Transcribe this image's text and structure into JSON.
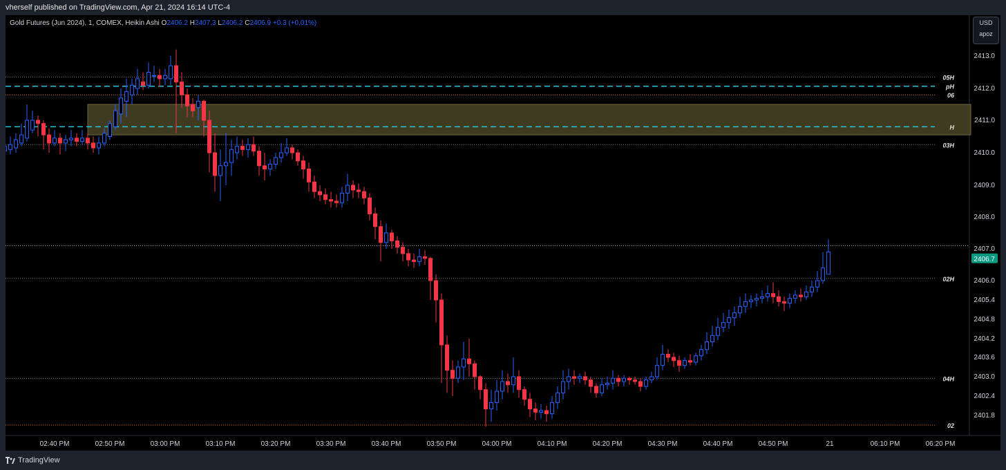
{
  "header": {
    "text": "vherself published on TradingView.com, Apr 21, 2024 16:14 UTC-4"
  },
  "legend": {
    "symbol": "Gold Futures (Jun 2024), 1, COMEX, Heikin Ashi",
    "o_label": "O",
    "o": "2406.2",
    "h_label": "H",
    "h": "2407.3",
    "l_label": "L",
    "l": "2406.2",
    "c_label": "C",
    "c": "2406.9",
    "change": "+0.3 (+0.01%)"
  },
  "currency": {
    "unit": "USD",
    "user": "apoz"
  },
  "footer": {
    "brand": "TradingView"
  },
  "colors": {
    "up": "#2962ff",
    "down": "#f23645",
    "zone": "#4a4526",
    "cyan": "#26c6da",
    "last_price_bg": "#089981"
  },
  "chart_data": {
    "type": "candlestick",
    "title": "",
    "y_ticks": [
      "2413.0",
      "2412.0",
      "2411.0",
      "2410.0",
      "2409.0",
      "2408.0",
      "2407.0",
      "2406.0",
      "2405.4",
      "2404.8",
      "2404.2",
      "2403.6",
      "2403.0",
      "2402.4",
      "2401.8"
    ],
    "x_ticks": [
      "02:40 PM",
      "02:50 PM",
      "03:00 PM",
      "03:10 PM",
      "03:20 PM",
      "03:30 PM",
      "03:40 PM",
      "03:50 PM",
      "04:00 PM",
      "04:10 PM",
      "04:20 PM",
      "04:30 PM",
      "04:40 PM",
      "04:50 PM",
      "21",
      "06:10 PM",
      "06:20 PM"
    ],
    "last_price": "2406.7",
    "levels": [
      {
        "label": "05H",
        "price": 2412.35,
        "style": "dotted",
        "color": "#787b86"
      },
      {
        "label": "pH",
        "price": 2412.07,
        "style": "dashed",
        "color": "#26c6da"
      },
      {
        "label": "06",
        "price": 2411.8,
        "style": "dotted",
        "color": "#f57c00"
      },
      {
        "label": "H",
        "price": 2410.8,
        "style": "dashed",
        "color": "#26c6da"
      },
      {
        "label": "03H",
        "price": 2410.25,
        "style": "dotted",
        "color": "#787b86"
      },
      {
        "label": "02H",
        "price": 2406.07,
        "style": "dotted",
        "color": "#787b86"
      },
      {
        "label": "04H",
        "price": 2402.95,
        "style": "dotted",
        "color": "#787b86"
      },
      {
        "label": "02",
        "price": 2401.5,
        "style": "dotted",
        "color": "#f57c00"
      }
    ],
    "current_line": {
      "price": 2407.1
    },
    "zone": {
      "top": 2411.5,
      "bottom": 2410.55,
      "from_time": "02:46 PM"
    },
    "candles": [
      [
        "02:30 PM",
        2410.0,
        2410.35,
        2409.75,
        2410.1
      ],
      [
        "02:31 PM",
        2410.05,
        2410.45,
        2409.9,
        2410.2
      ],
      [
        "02:32 PM",
        2410.1,
        2410.5,
        2409.95,
        2410.25
      ],
      [
        "02:33 PM",
        2410.15,
        2410.6,
        2410.0,
        2410.4
      ],
      [
        "02:34 PM",
        2410.3,
        2410.9,
        2410.2,
        2410.55
      ],
      [
        "02:35 PM",
        2410.45,
        2411.5,
        2410.35,
        2411.0
      ],
      [
        "02:36 PM",
        2410.7,
        2411.3,
        2410.6,
        2411.0
      ],
      [
        "02:37 PM",
        2411.0,
        2411.15,
        2410.5,
        2410.9
      ],
      [
        "02:38 PM",
        2410.9,
        2411.0,
        2410.1,
        2410.55
      ],
      [
        "02:39 PM",
        2410.55,
        2410.75,
        2410.0,
        2410.3
      ],
      [
        "02:40 PM",
        2410.3,
        2410.7,
        2410.2,
        2410.45
      ],
      [
        "02:41 PM",
        2410.45,
        2410.6,
        2409.95,
        2410.3
      ],
      [
        "02:42 PM",
        2410.3,
        2410.55,
        2410.05,
        2410.4
      ],
      [
        "02:43 PM",
        2410.4,
        2410.7,
        2410.2,
        2410.45
      ],
      [
        "02:44 PM",
        2410.45,
        2410.6,
        2410.2,
        2410.35
      ],
      [
        "02:45 PM",
        2410.35,
        2410.7,
        2410.25,
        2410.45
      ],
      [
        "02:46 PM",
        2410.45,
        2410.6,
        2410.1,
        2410.3
      ],
      [
        "02:47 PM",
        2410.3,
        2410.5,
        2410.0,
        2410.15
      ],
      [
        "02:48 PM",
        2410.15,
        2410.5,
        2409.95,
        2410.3
      ],
      [
        "02:49 PM",
        2410.3,
        2410.75,
        2410.2,
        2410.6
      ],
      [
        "02:50 PM",
        2410.5,
        2411.0,
        2410.4,
        2410.9
      ],
      [
        "02:51 PM",
        2410.8,
        2411.5,
        2410.7,
        2411.3
      ],
      [
        "02:52 PM",
        2411.2,
        2412.0,
        2410.9,
        2411.7
      ],
      [
        "02:53 PM",
        2411.6,
        2412.3,
        2411.1,
        2411.9
      ],
      [
        "02:54 PM",
        2411.8,
        2412.3,
        2411.5,
        2412.1
      ],
      [
        "02:55 PM",
        2412.0,
        2412.6,
        2411.8,
        2412.3
      ],
      [
        "02:56 PM",
        2412.2,
        2412.5,
        2411.95,
        2412.1
      ],
      [
        "02:57 PM",
        2412.1,
        2412.8,
        2412.0,
        2412.5
      ],
      [
        "02:58 PM",
        2412.4,
        2412.7,
        2412.2,
        2412.4
      ],
      [
        "02:59 PM",
        2412.4,
        2412.6,
        2412.05,
        2412.3
      ],
      [
        "03:00 PM",
        2412.3,
        2412.6,
        2412.1,
        2412.4
      ],
      [
        "03:01 PM",
        2412.3,
        2413.0,
        2412.1,
        2412.7
      ],
      [
        "03:02 PM",
        2412.7,
        2413.2,
        2410.6,
        2412.2
      ],
      [
        "03:03 PM",
        2412.2,
        2412.5,
        2411.4,
        2411.8
      ],
      [
        "03:04 PM",
        2411.8,
        2412.0,
        2411.1,
        2411.45
      ],
      [
        "03:05 PM",
        2411.5,
        2411.7,
        2411.1,
        2411.3
      ],
      [
        "03:06 PM",
        2411.4,
        2411.8,
        2411.0,
        2411.6
      ],
      [
        "03:07 PM",
        2411.6,
        2411.65,
        2410.5,
        2411.0
      ],
      [
        "03:08 PM",
        2411.0,
        2411.3,
        2409.4,
        2410.0
      ],
      [
        "03:09 PM",
        2410.0,
        2410.6,
        2408.8,
        2409.3
      ],
      [
        "03:10 PM",
        2409.3,
        2410.1,
        2408.5,
        2409.6
      ],
      [
        "03:11 PM",
        2409.6,
        2410.6,
        2409.0,
        2409.7
      ],
      [
        "03:12 PM",
        2409.7,
        2410.4,
        2409.3,
        2410.1
      ],
      [
        "03:13 PM",
        2410.0,
        2410.5,
        2409.8,
        2410.2
      ],
      [
        "03:14 PM",
        2410.2,
        2410.4,
        2409.9,
        2410.1
      ],
      [
        "03:15 PM",
        2410.1,
        2410.45,
        2409.85,
        2410.25
      ],
      [
        "03:16 PM",
        2410.25,
        2410.5,
        2409.9,
        2410.05
      ],
      [
        "03:17 PM",
        2410.05,
        2410.2,
        2409.3,
        2409.6
      ],
      [
        "03:18 PM",
        2409.6,
        2410.0,
        2409.15,
        2409.5
      ],
      [
        "03:19 PM",
        2409.5,
        2409.8,
        2409.3,
        2409.65
      ],
      [
        "03:20 PM",
        2409.65,
        2410.0,
        2409.5,
        2409.85
      ],
      [
        "03:21 PM",
        2409.85,
        2410.3,
        2409.7,
        2410.0
      ],
      [
        "03:22 PM",
        2410.0,
        2410.45,
        2409.9,
        2410.15
      ],
      [
        "03:23 PM",
        2410.15,
        2410.25,
        2409.8,
        2410.0
      ],
      [
        "03:24 PM",
        2410.0,
        2410.1,
        2409.6,
        2409.75
      ],
      [
        "03:25 PM",
        2409.75,
        2409.9,
        2409.2,
        2409.5
      ],
      [
        "03:26 PM",
        2409.5,
        2409.7,
        2408.8,
        2409.1
      ],
      [
        "03:27 PM",
        2409.1,
        2409.3,
        2408.6,
        2408.8
      ],
      [
        "03:28 PM",
        2408.8,
        2409.0,
        2408.5,
        2408.7
      ],
      [
        "03:29 PM",
        2408.7,
        2408.9,
        2408.4,
        2408.55
      ],
      [
        "03:30 PM",
        2408.55,
        2408.8,
        2408.3,
        2408.5
      ],
      [
        "03:31 PM",
        2408.5,
        2408.7,
        2408.3,
        2408.45
      ],
      [
        "03:32 PM",
        2408.45,
        2408.95,
        2408.3,
        2408.75
      ],
      [
        "03:33 PM",
        2408.75,
        2409.35,
        2408.5,
        2409.0
      ],
      [
        "03:34 PM",
        2409.0,
        2409.15,
        2408.6,
        2408.85
      ],
      [
        "03:35 PM",
        2408.85,
        2409.05,
        2408.6,
        2408.8
      ],
      [
        "03:36 PM",
        2408.8,
        2408.95,
        2408.4,
        2408.6
      ],
      [
        "03:37 PM",
        2408.6,
        2408.75,
        2407.9,
        2408.1
      ],
      [
        "03:38 PM",
        2408.1,
        2408.3,
        2407.3,
        2407.7
      ],
      [
        "03:39 PM",
        2407.7,
        2407.9,
        2406.6,
        2407.2
      ],
      [
        "03:40 PM",
        2407.2,
        2407.8,
        2407.0,
        2407.5
      ],
      [
        "03:41 PM",
        2407.5,
        2407.6,
        2407.0,
        2407.25
      ],
      [
        "03:42 PM",
        2407.25,
        2407.4,
        2406.85,
        2407.05
      ],
      [
        "03:43 PM",
        2407.05,
        2407.2,
        2406.6,
        2406.85
      ],
      [
        "03:44 PM",
        2406.85,
        2407.0,
        2406.45,
        2406.65
      ],
      [
        "03:45 PM",
        2406.65,
        2406.85,
        2406.4,
        2406.6
      ],
      [
        "03:46 PM",
        2406.6,
        2407.0,
        2406.45,
        2406.75
      ],
      [
        "03:47 PM",
        2406.75,
        2406.95,
        2406.5,
        2406.7
      ],
      [
        "03:48 PM",
        2406.7,
        2406.75,
        2405.4,
        2406.0
      ],
      [
        "03:49 PM",
        2406.0,
        2406.2,
        2404.7,
        2405.4
      ],
      [
        "03:50 PM",
        2405.4,
        2405.6,
        2402.8,
        2404.0
      ],
      [
        "03:51 PM",
        2404.0,
        2404.3,
        2402.5,
        2403.2
      ],
      [
        "03:52 PM",
        2403.2,
        2403.5,
        2402.4,
        2402.95
      ],
      [
        "03:53 PM",
        2402.95,
        2403.5,
        2402.8,
        2403.3
      ],
      [
        "03:54 PM",
        2403.3,
        2404.1,
        2402.9,
        2403.55
      ],
      [
        "03:55 PM",
        2403.55,
        2404.2,
        2403.0,
        2403.4
      ],
      [
        "03:56 PM",
        2403.4,
        2403.5,
        2402.6,
        2403.0
      ],
      [
        "03:57 PM",
        2403.0,
        2403.05,
        2402.3,
        2402.6
      ],
      [
        "03:58 PM",
        2402.6,
        2402.8,
        2401.45,
        2402.0
      ],
      [
        "03:59 PM",
        2402.0,
        2402.6,
        2401.6,
        2402.2
      ],
      [
        "04:00 PM",
        2402.2,
        2402.9,
        2401.95,
        2402.55
      ],
      [
        "04:01 PM",
        2402.55,
        2403.2,
        2402.3,
        2402.85
      ],
      [
        "04:02 PM",
        2402.85,
        2403.1,
        2402.5,
        2402.75
      ],
      [
        "04:03 PM",
        2402.75,
        2403.6,
        2402.5,
        2403.0
      ],
      [
        "04:04 PM",
        2403.0,
        2403.2,
        2402.35,
        2402.6
      ],
      [
        "04:05 PM",
        2402.6,
        2402.7,
        2402.1,
        2402.3
      ],
      [
        "04:06 PM",
        2402.3,
        2402.5,
        2401.75,
        2402.0
      ],
      [
        "04:07 PM",
        2402.0,
        2402.2,
        2401.65,
        2401.9
      ],
      [
        "04:08 PM",
        2401.9,
        2402.15,
        2401.7,
        2401.95
      ],
      [
        "04:09 PM",
        2401.95,
        2402.1,
        2401.6,
        2401.85
      ],
      [
        "04:10 PM",
        2401.85,
        2402.4,
        2401.7,
        2402.2
      ],
      [
        "04:11 PM",
        2402.2,
        2402.7,
        2402.0,
        2402.5
      ],
      [
        "04:12 PM",
        2402.5,
        2403.2,
        2402.3,
        2402.85
      ],
      [
        "04:13 PM",
        2402.85,
        2403.25,
        2402.6,
        2403.0
      ],
      [
        "04:14 PM",
        2403.0,
        2403.2,
        2402.75,
        2402.95
      ],
      [
        "04:15 PM",
        2402.95,
        2403.1,
        2402.8,
        2403.0
      ],
      [
        "04:16 PM",
        2403.0,
        2403.15,
        2402.75,
        2402.9
      ],
      [
        "04:17 PM",
        2402.9,
        2403.0,
        2402.5,
        2402.7
      ],
      [
        "04:18 PM",
        2402.7,
        2402.8,
        2402.35,
        2402.5
      ],
      [
        "04:19 PM",
        2402.5,
        2402.95,
        2402.4,
        2402.75
      ],
      [
        "04:20 PM",
        2402.75,
        2403.0,
        2402.6,
        2402.8
      ],
      [
        "04:21 PM",
        2402.8,
        2403.2,
        2402.6,
        2402.95
      ],
      [
        "04:22 PM",
        2402.95,
        2403.05,
        2402.7,
        2402.85
      ],
      [
        "04:23 PM",
        2402.85,
        2403.05,
        2402.7,
        2402.95
      ],
      [
        "04:24 PM",
        2402.95,
        2403.0,
        2402.75,
        2402.9
      ],
      [
        "04:25 PM",
        2402.9,
        2403.0,
        2402.75,
        2402.85
      ],
      [
        "04:26 PM",
        2402.85,
        2402.95,
        2402.55,
        2402.7
      ],
      [
        "04:27 PM",
        2402.7,
        2403.0,
        2402.6,
        2402.9
      ],
      [
        "04:28 PM",
        2402.9,
        2403.15,
        2402.8,
        2403.0
      ],
      [
        "04:29 PM",
        2403.0,
        2403.6,
        2402.9,
        2403.35
      ],
      [
        "04:30 PM",
        2403.35,
        2404.0,
        2403.2,
        2403.7
      ],
      [
        "04:31 PM",
        2403.7,
        2403.85,
        2403.45,
        2403.6
      ],
      [
        "04:32 PM",
        2403.6,
        2403.75,
        2403.3,
        2403.5
      ],
      [
        "04:33 PM",
        2403.5,
        2403.65,
        2403.15,
        2403.35
      ],
      [
        "04:34 PM",
        2403.35,
        2403.6,
        2403.25,
        2403.5
      ],
      [
        "04:35 PM",
        2403.5,
        2403.7,
        2403.35,
        2403.45
      ],
      [
        "04:36 PM",
        2403.45,
        2403.75,
        2403.35,
        2403.65
      ],
      [
        "04:37 PM",
        2403.65,
        2404.0,
        2403.5,
        2403.85
      ],
      [
        "04:38 PM",
        2403.85,
        2404.4,
        2403.7,
        2404.1
      ],
      [
        "04:39 PM",
        2404.1,
        2404.6,
        2403.95,
        2404.3
      ],
      [
        "04:40 PM",
        2404.3,
        2404.85,
        2404.15,
        2404.55
      ],
      [
        "04:41 PM",
        2404.55,
        2405.0,
        2404.4,
        2404.7
      ],
      [
        "04:42 PM",
        2404.7,
        2405.1,
        2404.5,
        2404.85
      ],
      [
        "04:43 PM",
        2404.85,
        2405.2,
        2404.6,
        2405.0
      ],
      [
        "04:44 PM",
        2405.0,
        2405.5,
        2404.85,
        2405.2
      ],
      [
        "04:45 PM",
        2405.2,
        2405.6,
        2405.0,
        2405.35
      ],
      [
        "04:46 PM",
        2405.35,
        2405.55,
        2405.15,
        2405.4
      ],
      [
        "04:47 PM",
        2405.4,
        2405.6,
        2405.2,
        2405.45
      ],
      [
        "04:48 PM",
        2405.45,
        2405.7,
        2405.3,
        2405.5
      ],
      [
        "04:49 PM",
        2405.5,
        2405.85,
        2405.35,
        2405.6
      ],
      [
        "04:50 PM",
        2405.6,
        2405.95,
        2405.3,
        2405.5
      ],
      [
        "04:51 PM",
        2405.5,
        2405.7,
        2405.2,
        2405.35
      ],
      [
        "04:52 PM",
        2405.35,
        2405.5,
        2405.05,
        2405.3
      ],
      [
        "04:53 PM",
        2405.3,
        2405.6,
        2405.15,
        2405.45
      ],
      [
        "04:54 PM",
        2405.45,
        2405.7,
        2405.3,
        2405.55
      ],
      [
        "04:55 PM",
        2405.55,
        2405.75,
        2405.35,
        2405.5
      ],
      [
        "04:56 PM",
        2405.5,
        2405.85,
        2405.4,
        2405.65
      ],
      [
        "04:57 PM",
        2405.65,
        2406.0,
        2405.5,
        2405.8
      ],
      [
        "04:58 PM",
        2405.8,
        2406.3,
        2405.65,
        2406.0
      ],
      [
        "04:59 PM",
        2406.0,
        2406.9,
        2405.9,
        2406.4
      ],
      [
        "05:00 PM",
        2406.2,
        2407.3,
        2406.2,
        2406.9
      ]
    ]
  }
}
